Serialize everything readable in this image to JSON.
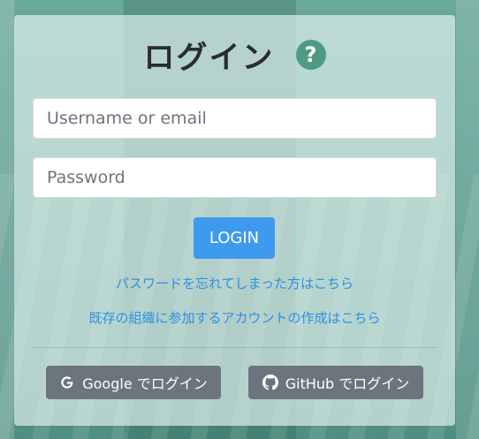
{
  "login": {
    "title": "ログイン",
    "help_icon": "?",
    "username_placeholder": "Username or email",
    "password_placeholder": "Password",
    "login_button": "LOGIN",
    "forgot_password_link": "パスワードを忘れてしまった方はこちら",
    "create_account_link": "既存の組織に参加するアカウントの作成はこちら",
    "google_button": "Google でログイン",
    "github_button": "GitHub でログイン"
  },
  "icons": {
    "help": "question-circle-icon",
    "google": "google-icon",
    "github": "github-icon"
  },
  "colors": {
    "primary_button": "#3d9aee",
    "link": "#2f8fe3",
    "social_button": "#6c757d",
    "help_icon": "#4f9a83"
  }
}
